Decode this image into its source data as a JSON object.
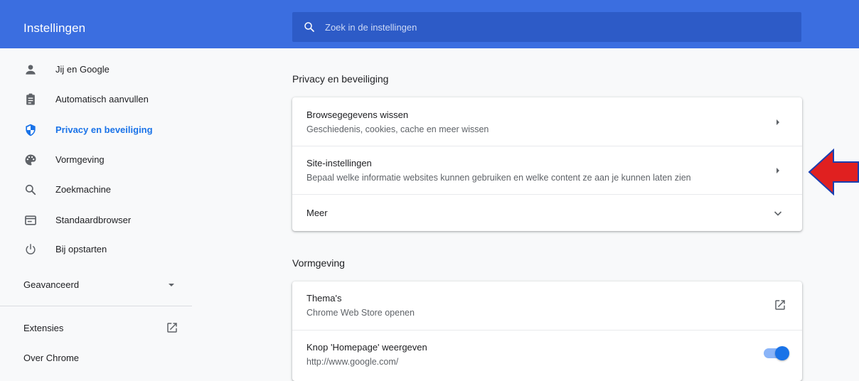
{
  "header": {
    "title": "Instellingen",
    "search_placeholder": "Zoek in de instellingen"
  },
  "sidebar": {
    "items": [
      {
        "label": "Jij en Google",
        "icon": "person-icon"
      },
      {
        "label": "Automatisch aanvullen",
        "icon": "clipboard-icon"
      },
      {
        "label": "Privacy en beveiliging",
        "icon": "shield-icon",
        "active": true
      },
      {
        "label": "Vormgeving",
        "icon": "palette-icon"
      },
      {
        "label": "Zoekmachine",
        "icon": "search-icon"
      },
      {
        "label": "Standaardbrowser",
        "icon": "browser-window-icon"
      },
      {
        "label": "Bij opstarten",
        "icon": "power-icon"
      }
    ],
    "advanced_label": "Geavanceerd",
    "extensions_label": "Extensies",
    "about_label": "Over Chrome"
  },
  "privacy_section": {
    "title": "Privacy en beveiliging",
    "rows": [
      {
        "primary": "Browsegegevens wissen",
        "secondary": "Geschiedenis, cookies, cache en meer wissen"
      },
      {
        "primary": "Site-instellingen",
        "secondary": "Bepaal welke informatie websites kunnen gebruiken en welke content ze aan je kunnen laten zien"
      },
      {
        "primary": "Meer"
      }
    ]
  },
  "appearance_section": {
    "title": "Vormgeving",
    "rows": [
      {
        "primary": "Thema's",
        "secondary": "Chrome Web Store openen"
      },
      {
        "primary": "Knop 'Homepage' weergeven",
        "secondary": "http://www.google.com/",
        "toggle_on": true
      }
    ]
  },
  "colors": {
    "header": "#3b6ee0",
    "accent": "#1a73e8",
    "annotation_arrow": "#e02020"
  }
}
